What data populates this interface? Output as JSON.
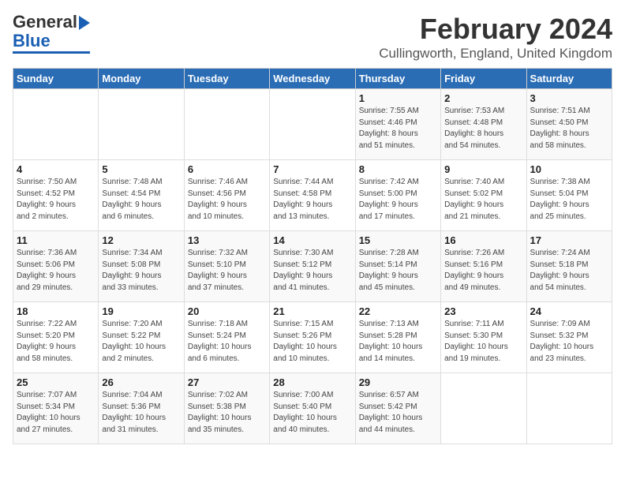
{
  "header": {
    "logo_line1": "General",
    "logo_line2": "Blue",
    "title": "February 2024",
    "subtitle": "Cullingworth, England, United Kingdom"
  },
  "days_of_week": [
    "Sunday",
    "Monday",
    "Tuesday",
    "Wednesday",
    "Thursday",
    "Friday",
    "Saturday"
  ],
  "weeks": [
    [
      {
        "day": "",
        "info": ""
      },
      {
        "day": "",
        "info": ""
      },
      {
        "day": "",
        "info": ""
      },
      {
        "day": "",
        "info": ""
      },
      {
        "day": "1",
        "info": "Sunrise: 7:55 AM\nSunset: 4:46 PM\nDaylight: 8 hours\nand 51 minutes."
      },
      {
        "day": "2",
        "info": "Sunrise: 7:53 AM\nSunset: 4:48 PM\nDaylight: 8 hours\nand 54 minutes."
      },
      {
        "day": "3",
        "info": "Sunrise: 7:51 AM\nSunset: 4:50 PM\nDaylight: 8 hours\nand 58 minutes."
      }
    ],
    [
      {
        "day": "4",
        "info": "Sunrise: 7:50 AM\nSunset: 4:52 PM\nDaylight: 9 hours\nand 2 minutes."
      },
      {
        "day": "5",
        "info": "Sunrise: 7:48 AM\nSunset: 4:54 PM\nDaylight: 9 hours\nand 6 minutes."
      },
      {
        "day": "6",
        "info": "Sunrise: 7:46 AM\nSunset: 4:56 PM\nDaylight: 9 hours\nand 10 minutes."
      },
      {
        "day": "7",
        "info": "Sunrise: 7:44 AM\nSunset: 4:58 PM\nDaylight: 9 hours\nand 13 minutes."
      },
      {
        "day": "8",
        "info": "Sunrise: 7:42 AM\nSunset: 5:00 PM\nDaylight: 9 hours\nand 17 minutes."
      },
      {
        "day": "9",
        "info": "Sunrise: 7:40 AM\nSunset: 5:02 PM\nDaylight: 9 hours\nand 21 minutes."
      },
      {
        "day": "10",
        "info": "Sunrise: 7:38 AM\nSunset: 5:04 PM\nDaylight: 9 hours\nand 25 minutes."
      }
    ],
    [
      {
        "day": "11",
        "info": "Sunrise: 7:36 AM\nSunset: 5:06 PM\nDaylight: 9 hours\nand 29 minutes."
      },
      {
        "day": "12",
        "info": "Sunrise: 7:34 AM\nSunset: 5:08 PM\nDaylight: 9 hours\nand 33 minutes."
      },
      {
        "day": "13",
        "info": "Sunrise: 7:32 AM\nSunset: 5:10 PM\nDaylight: 9 hours\nand 37 minutes."
      },
      {
        "day": "14",
        "info": "Sunrise: 7:30 AM\nSunset: 5:12 PM\nDaylight: 9 hours\nand 41 minutes."
      },
      {
        "day": "15",
        "info": "Sunrise: 7:28 AM\nSunset: 5:14 PM\nDaylight: 9 hours\nand 45 minutes."
      },
      {
        "day": "16",
        "info": "Sunrise: 7:26 AM\nSunset: 5:16 PM\nDaylight: 9 hours\nand 49 minutes."
      },
      {
        "day": "17",
        "info": "Sunrise: 7:24 AM\nSunset: 5:18 PM\nDaylight: 9 hours\nand 54 minutes."
      }
    ],
    [
      {
        "day": "18",
        "info": "Sunrise: 7:22 AM\nSunset: 5:20 PM\nDaylight: 9 hours\nand 58 minutes."
      },
      {
        "day": "19",
        "info": "Sunrise: 7:20 AM\nSunset: 5:22 PM\nDaylight: 10 hours\nand 2 minutes."
      },
      {
        "day": "20",
        "info": "Sunrise: 7:18 AM\nSunset: 5:24 PM\nDaylight: 10 hours\nand 6 minutes."
      },
      {
        "day": "21",
        "info": "Sunrise: 7:15 AM\nSunset: 5:26 PM\nDaylight: 10 hours\nand 10 minutes."
      },
      {
        "day": "22",
        "info": "Sunrise: 7:13 AM\nSunset: 5:28 PM\nDaylight: 10 hours\nand 14 minutes."
      },
      {
        "day": "23",
        "info": "Sunrise: 7:11 AM\nSunset: 5:30 PM\nDaylight: 10 hours\nand 19 minutes."
      },
      {
        "day": "24",
        "info": "Sunrise: 7:09 AM\nSunset: 5:32 PM\nDaylight: 10 hours\nand 23 minutes."
      }
    ],
    [
      {
        "day": "25",
        "info": "Sunrise: 7:07 AM\nSunset: 5:34 PM\nDaylight: 10 hours\nand 27 minutes."
      },
      {
        "day": "26",
        "info": "Sunrise: 7:04 AM\nSunset: 5:36 PM\nDaylight: 10 hours\nand 31 minutes."
      },
      {
        "day": "27",
        "info": "Sunrise: 7:02 AM\nSunset: 5:38 PM\nDaylight: 10 hours\nand 35 minutes."
      },
      {
        "day": "28",
        "info": "Sunrise: 7:00 AM\nSunset: 5:40 PM\nDaylight: 10 hours\nand 40 minutes."
      },
      {
        "day": "29",
        "info": "Sunrise: 6:57 AM\nSunset: 5:42 PM\nDaylight: 10 hours\nand 44 minutes."
      },
      {
        "day": "",
        "info": ""
      },
      {
        "day": "",
        "info": ""
      }
    ]
  ]
}
